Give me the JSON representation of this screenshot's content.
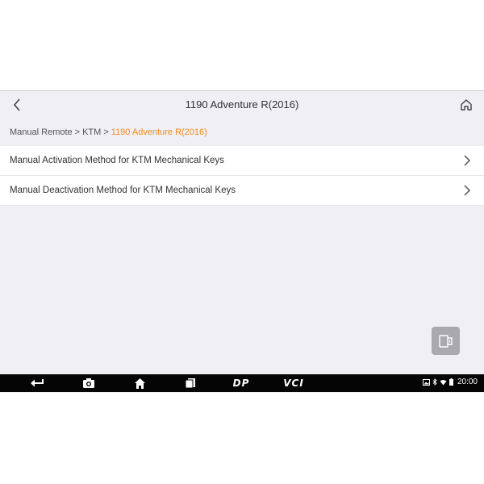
{
  "header": {
    "title": "1190 Adventure R(2016)",
    "back_icon": "chevron-left-icon",
    "home_icon": "home-icon"
  },
  "breadcrumb": {
    "items": [
      "Manual Remote",
      "KTM"
    ],
    "separator": ">",
    "current": "1190 Adventure R(2016)",
    "current_color": "#f08a1c"
  },
  "menu": {
    "items": [
      {
        "label": "Manual Activation Method for KTM Mechanical Keys",
        "icon": "chevron-right-icon"
      },
      {
        "label": "Manual Deactivation Method for KTM Mechanical Keys",
        "icon": "chevron-right-icon"
      }
    ]
  },
  "floating_button": {
    "icon": "split-view-icon"
  },
  "nav_bar": {
    "buttons": [
      {
        "icon": "back-arrow-icon"
      },
      {
        "icon": "camera-icon"
      },
      {
        "icon": "home-icon"
      },
      {
        "icon": "recent-apps-icon"
      },
      {
        "label": "DP",
        "icon": "dp-icon"
      },
      {
        "label": "VCI",
        "icon": "vci-icon"
      }
    ],
    "status": {
      "icons": [
        "image-icon",
        "bluetooth-icon",
        "wifi-icon",
        "battery-icon"
      ],
      "time": "20:00"
    }
  },
  "colors": {
    "background": "#efeff4",
    "accent": "#f08a1c",
    "nav_bar": "#050505"
  }
}
